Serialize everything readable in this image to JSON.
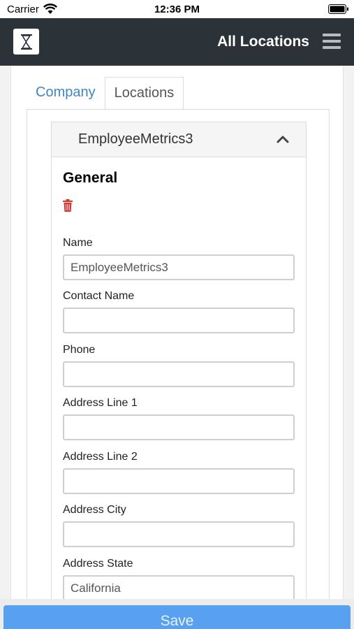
{
  "status_bar": {
    "carrier": "Carrier",
    "time": "12:36 PM"
  },
  "header": {
    "title": "All Locations",
    "logo_icon": "hourglass-logo-icon",
    "menu_icon": "hamburger-menu-icon"
  },
  "tabs": [
    {
      "label": "Company",
      "active": false
    },
    {
      "label": "Locations",
      "active": true
    }
  ],
  "location": {
    "title": "EmployeeMetrics3",
    "section_heading": "General",
    "fields": [
      {
        "label": "Name",
        "value": "EmployeeMetrics3"
      },
      {
        "label": "Contact Name",
        "value": ""
      },
      {
        "label": "Phone",
        "value": ""
      },
      {
        "label": "Address Line 1",
        "value": ""
      },
      {
        "label": "Address Line 2",
        "value": ""
      },
      {
        "label": "Address City",
        "value": ""
      },
      {
        "label": "Address State",
        "value": "California"
      }
    ]
  },
  "save_label": "Save",
  "colors": {
    "header_bg": "#2b3339",
    "link": "#3d86c9",
    "delete": "#e0302a",
    "save_button": "#58a0f0"
  }
}
